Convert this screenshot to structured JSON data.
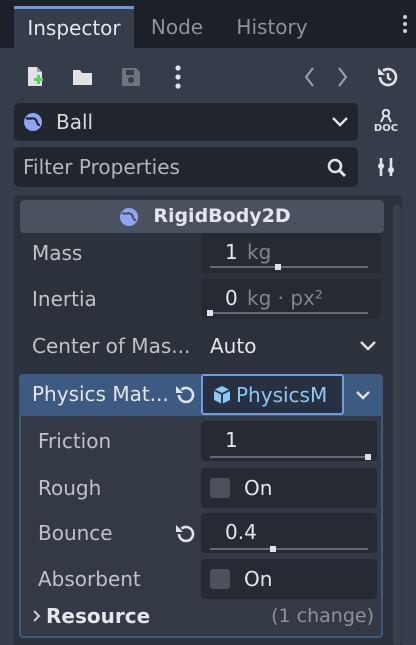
{
  "tabs": [
    {
      "label": "Inspector",
      "active": true
    },
    {
      "label": "Node",
      "active": false
    },
    {
      "label": "History",
      "active": false
    }
  ],
  "toolbar": {
    "icons": [
      "new-resource-icon",
      "open-folder-icon",
      "save-icon",
      "more-vertical-icon",
      "history-back-icon",
      "history-forward-icon",
      "object-history-icon"
    ]
  },
  "object_selector": {
    "value": "Ball",
    "icon": "node-globe-icon"
  },
  "doc_icon_label": "DOC",
  "filter": {
    "placeholder": "Filter Properties"
  },
  "section": {
    "title": "RigidBody2D"
  },
  "properties": {
    "mass": {
      "label": "Mass",
      "value": "1",
      "unit": "kg",
      "slider_fraction": 0.43
    },
    "inertia": {
      "label": "Inertia",
      "value": "0",
      "unit": "kg · px²",
      "slider_fraction": 0.0
    },
    "center_of_mass": {
      "label": "Center of Mas...",
      "value": "Auto"
    },
    "physics_material": {
      "label": "Physics Mat...",
      "value": "PhysicsM"
    }
  },
  "material": {
    "friction": {
      "label": "Friction",
      "value": "1",
      "slider_fraction": 1.0
    },
    "rough": {
      "label": "Rough",
      "value": "On",
      "checked": false
    },
    "bounce": {
      "label": "Bounce",
      "value": "0.4",
      "slider_fraction": 0.4
    },
    "absorbent": {
      "label": "Absorbent",
      "value": "On",
      "checked": false
    },
    "resource": {
      "label": "Resource",
      "changes": "(1 change)"
    }
  },
  "colors": {
    "accent": "#6f95d8",
    "panel": "#363d4a",
    "field": "#21262e",
    "highlight": "#3d5a80"
  }
}
